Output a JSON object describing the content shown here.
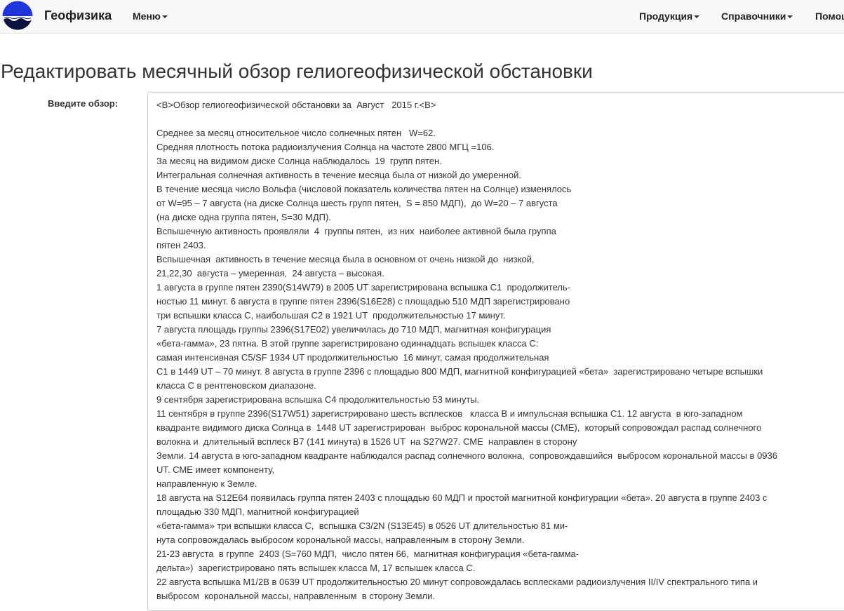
{
  "header": {
    "brand": "Геофизика",
    "nav": {
      "menu": "Меню",
      "products": "Продукция",
      "references": "Справочники",
      "help": "Помощь"
    }
  },
  "page": {
    "title": "Редактировать месячный обзор гелиогеофизической обстановки",
    "label": "Введите обзор:"
  },
  "review": {
    "lines": [
      "<B>Обзор гелиогеофизической обстановки за  Август   2015 г.<B>",
      "",
      "Среднее за месяц относительное число солнечных пятен   W=62.",
      "Средняя плотность потока радиоизлучения Солнца на частоте 2800 МГЦ =106.",
      "За месяц на видимом диске Солнца наблюдалось  19  групп пятен.",
      "Интегральная солнечная активность в течение месяца была от низкой до умеренной.",
      "В течение месяца число Вольфа (числовой показатель количества пятен на Солнце) изменялось",
      "от W=95 – 7 августа (на диске Солнца шесть групп пятен,  S = 850 МДП),  до W=20 – 7 августа",
      "(на диске одна группа пятен, S=30 МДП).",
      "Вспышечную активность проявляли  4  группы пятен,  из них  наиболее активной была группа",
      "пятен 2403.",
      "Вспышечная  активность в течение месяца была в основном от очень низкой до  низкой,",
      "21,22,30  августа – умеренная,  24 августа – высокая.",
      "1 августа в группе пятен 2390(S14W79) в 2005 UT зарегистрирована вспышка С1  продолжитель-",
      "ностью 11 минут. 6 августа в группе пятен 2396(S16E28) с площадью 510 МДП зарегистрировано",
      "три вспышки класса С, наибольшая С2 в 1921 UT  продолжительностью 17 минут.",
      "7 августа площадь группы 2396(S17E02) увеличилась до 710 МДП, магнитная конфигурация",
      "«бета-гамма», 23 пятна. В этой группе зарегистрировано одиннадцать вспышек класса С:",
      "самая интенсивная С5/SF 1934 UT продолжительностью  16 минут, самая продолжительная",
      "С1 в 1449 UT – 70 минут. 8 августа в группе 2396 с площадью 800 МДП, магнитной конфигурацией «бета»  зарегистрировано четыре вспышки",
      "класса С в рентгеновском диапазоне.",
      "9 сентября зарегистрирована вспышка С4 продолжительностью 53 минуты.",
      "11 сентября в группе 2396(S17W51) зарегистрировано шесть всплесков   класса В и импульсная вспышка С1. 12 августа  в юго-западном",
      "квадранте видимого диска Солнца в  1448 UT зарегистрирован  выброс корональной массы (СМЕ),  который сопровождал распад солнечного",
      "волокна и  длительный всплеск В7 (141 минута) в 1526 UT  на S27W27. СМЕ  направлен в сторону",
      "Земли. 14 августа в юго-западном квадранте наблюдался распад солнечного волокна,  сопровождавшийся  выбросом корональной массы в 0936",
      "UT. СМЕ имеет компоненту,",
      "направленную к Земле.",
      "18 августа на S12E64 появилась группа пятен 2403 с площадью 60 МДП и простой магнитной конфигурации «бета». 20 августа в группе 2403 с",
      "площадью 330 МДП, магнитной конфигурацией",
      "«бета-гамма» три вспышки класса С,  вспышка С3/2N (S13E45) в 0526 UT длительностью 81 ми-",
      "нута сопровождалась выбросом корональной массы, направленным в сторону Земли.",
      "21-23 августа  в группе  2403 (S=760 МДП,  число пятен 66,  магнитная конфигурация «бета-гамма-",
      "дельта»)  зарегистрировано пять вспышек класса М, 17 вспышек класса С.",
      "22 августа вспышка М1/2В в 0639 UT продолжительностью 20 минут сопровождалась всплесками радиоизлучения II/IV спектрального типа и",
      "выбросом  корональной массы, направленным  в сторону Земли."
    ]
  },
  "colors": {
    "logo_blue": "#1e35d9",
    "logo_dark": "#0b1240",
    "navbar_bg": "#f8f8f8",
    "border": "#cccccc"
  }
}
